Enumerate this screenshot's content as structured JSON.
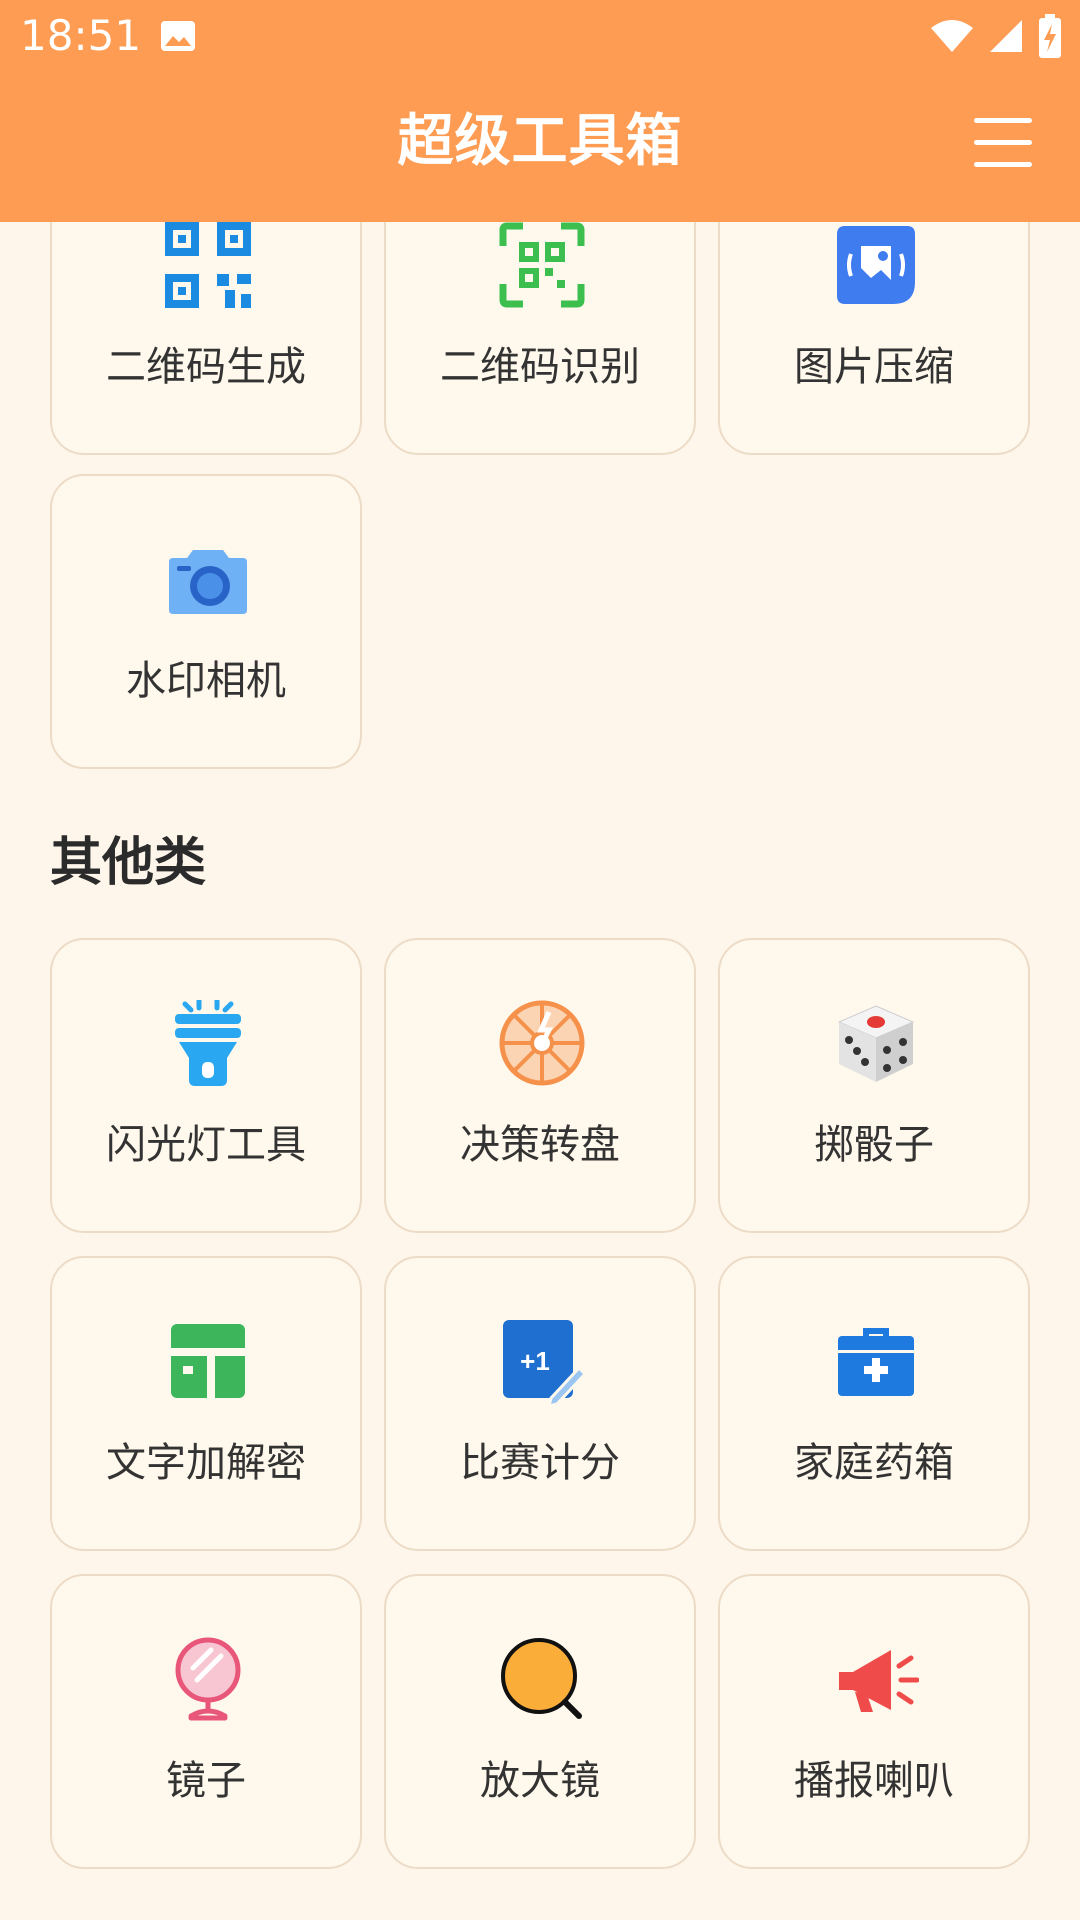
{
  "status_bar": {
    "time": "18:51"
  },
  "app_bar": {
    "title": "超级工具箱"
  },
  "tools_top": [
    {
      "label": "二维码生成",
      "icon": "qr-code-icon"
    },
    {
      "label": "二维码识别",
      "icon": "qr-scan-icon"
    },
    {
      "label": "图片压缩",
      "icon": "image-compress-icon"
    },
    {
      "label": "水印相机",
      "icon": "camera-icon"
    }
  ],
  "sections": [
    {
      "title": "其他类",
      "tools": [
        {
          "label": "闪光灯工具",
          "icon": "flashlight-icon"
        },
        {
          "label": "决策转盘",
          "icon": "wheel-icon"
        },
        {
          "label": "掷骰子",
          "icon": "dice-icon"
        },
        {
          "label": "文字加解密",
          "icon": "encrypt-icon"
        },
        {
          "label": "比赛计分",
          "icon": "score-icon"
        },
        {
          "label": "家庭药箱",
          "icon": "medicine-box-icon"
        },
        {
          "label": "镜子",
          "icon": "mirror-icon"
        },
        {
          "label": "放大镜",
          "icon": "magnifier-icon"
        },
        {
          "label": "播报喇叭",
          "icon": "megaphone-icon"
        }
      ]
    }
  ],
  "colors": {
    "accent": "#fd9c52",
    "background": "#fef6ea",
    "card": "#fff8ec",
    "card_border": "#ecdcc7"
  }
}
